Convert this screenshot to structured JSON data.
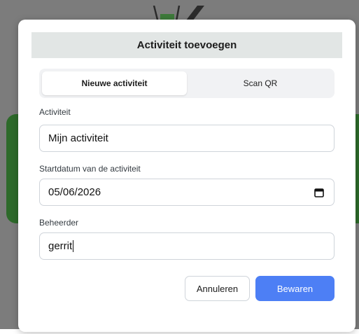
{
  "modal": {
    "title": "Activiteit toevoegen"
  },
  "tabs": [
    {
      "label": "Nieuwe activiteit",
      "active": true
    },
    {
      "label": "Scan QR",
      "active": false
    }
  ],
  "fields": {
    "activity": {
      "label": "Activiteit",
      "value": "Mijn activiteit"
    },
    "start_date": {
      "label": "Startdatum van de activiteit",
      "value": "05/06/2026",
      "icon": "calendar-icon"
    },
    "manager": {
      "label": "Beheerder",
      "value": "gerrit"
    }
  },
  "buttons": {
    "cancel_label": "Annuleren",
    "save_label": "Bewaren"
  },
  "colors": {
    "primary": "#4d7ff5",
    "header_bg": "#e2e6e5",
    "backdrop": "#7c7c7c",
    "background_green": "#2d6a2a"
  }
}
